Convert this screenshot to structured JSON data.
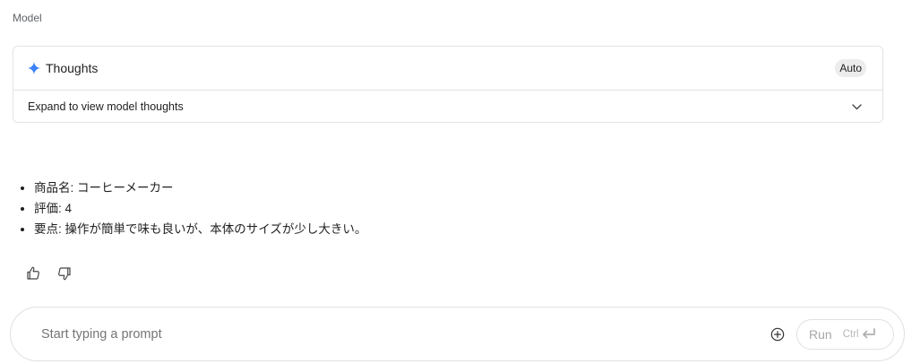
{
  "header": {
    "model_label": "Model"
  },
  "thoughts": {
    "icon": "sparkle-icon",
    "title": "Thoughts",
    "badge": "Auto",
    "expand_text": "Expand to view model thoughts",
    "accent_color": "#3b82f6"
  },
  "response": {
    "items": [
      "商品名: コーヒーメーカー",
      "評価: 4",
      "要点: 操作が簡単で味も良いが、本体のサイズが少し大きい。"
    ]
  },
  "feedback": {
    "like_icon": "thumbs-up-icon",
    "dislike_icon": "thumbs-down-icon"
  },
  "prompt": {
    "placeholder": "Start typing a prompt",
    "value": "",
    "add_icon": "add-circle-icon",
    "run_label": "Run",
    "shortcut_label": "Ctrl",
    "shortcut_icon": "enter-key-icon"
  }
}
